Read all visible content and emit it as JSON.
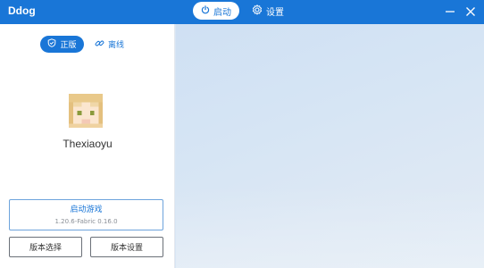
{
  "app": {
    "title": "Ddog"
  },
  "nav": {
    "launch_label": "启动",
    "settings_label": "设置"
  },
  "account": {
    "online_label": "正版",
    "offline_label": "离线",
    "username": "Thexiaoyu"
  },
  "launch": {
    "title": "启动游戏",
    "version": "1.20.6-Fabric 0.16.0"
  },
  "buttons": {
    "version_select": "版本选择",
    "version_settings": "版本设置"
  },
  "colors": {
    "accent": "#1976d7",
    "background": "#d8e6f4"
  },
  "icons": {
    "launch": "power-icon",
    "settings": "gear-icon",
    "online": "shield-check-icon",
    "offline": "link-icon",
    "minimize": "minimize-icon",
    "close": "close-icon"
  }
}
